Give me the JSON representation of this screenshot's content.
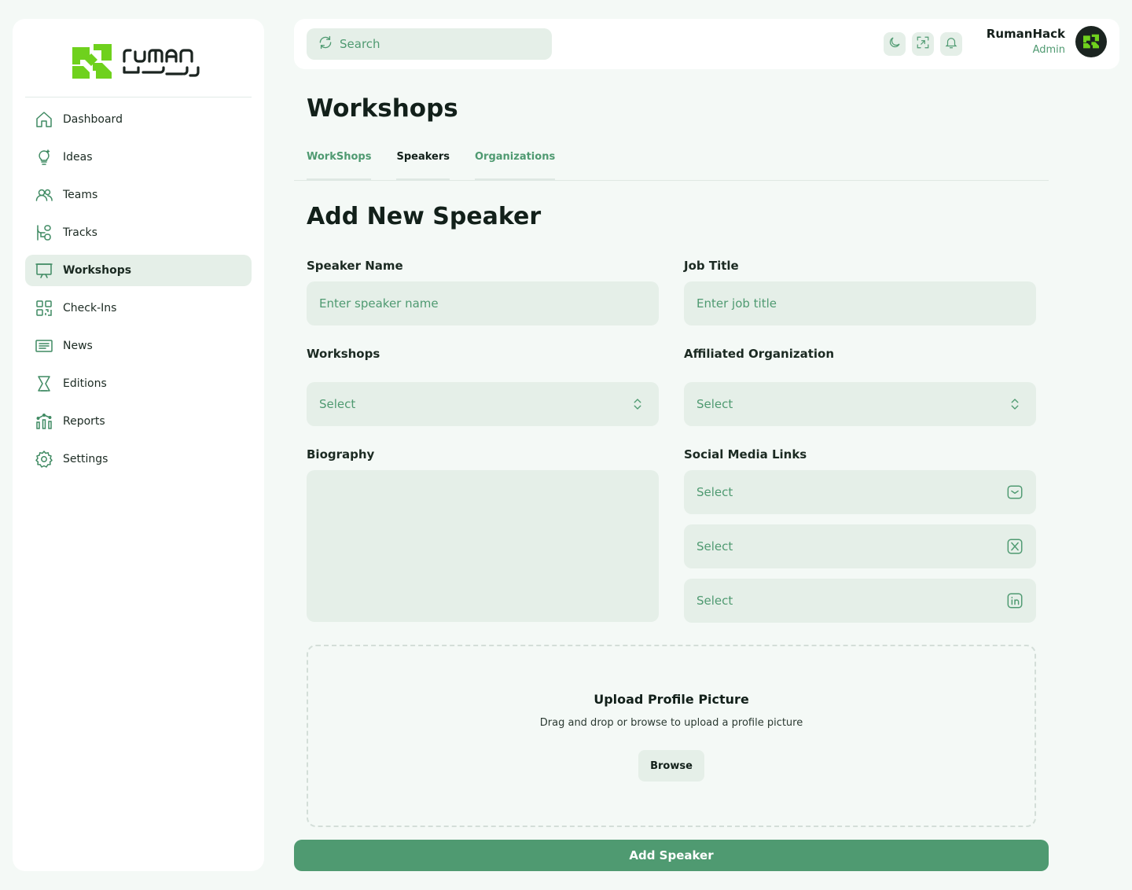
{
  "brand": {
    "name": "ruman",
    "accent": "#6fd11d",
    "primary": "#4f9a71"
  },
  "sidebar": {
    "items": [
      {
        "label": "Dashboard",
        "icon": "home-icon"
      },
      {
        "label": "Ideas",
        "icon": "lightbulb-icon"
      },
      {
        "label": "Teams",
        "icon": "users-icon"
      },
      {
        "label": "Tracks",
        "icon": "tracks-icon"
      },
      {
        "label": "Workshops",
        "icon": "presentation-icon",
        "active": true
      },
      {
        "label": "Check-Ins",
        "icon": "qr-code-icon"
      },
      {
        "label": "News",
        "icon": "newspaper-icon"
      },
      {
        "label": "Editions",
        "icon": "trophy-icon"
      },
      {
        "label": "Reports",
        "icon": "chart-icon"
      },
      {
        "label": "Settings",
        "icon": "gear-icon"
      }
    ]
  },
  "topbar": {
    "search_placeholder": "Search",
    "user_name": "RumanHack",
    "user_role": "Admin"
  },
  "page": {
    "title": "Workshops",
    "tabs": [
      {
        "label": "WorkShops"
      },
      {
        "label": "Speakers",
        "active": true
      },
      {
        "label": "Organizations"
      }
    ],
    "section_title": "Add New Speaker"
  },
  "form": {
    "speaker_name": {
      "label": "Speaker Name",
      "placeholder": "Enter  speaker name"
    },
    "job_title": {
      "label": "Job Title",
      "placeholder": "Enter  job title"
    },
    "workshops": {
      "label": "Workshops",
      "value": "Select"
    },
    "organization": {
      "label": "Affiliated Organization",
      "value": "Select"
    },
    "biography": {
      "label": "Biography"
    },
    "social": {
      "label": "Social Media Links",
      "links": [
        {
          "value": "Select",
          "icon": "email-icon"
        },
        {
          "value": "Select",
          "icon": "x-icon"
        },
        {
          "value": "Select",
          "icon": "linkedin-icon"
        }
      ]
    },
    "upload": {
      "title": "Upload Profile Picture",
      "description": "Drag and drop or browse to upload a profile picture",
      "browse_label": "Browse"
    },
    "submit_label": "Add Speaker"
  }
}
